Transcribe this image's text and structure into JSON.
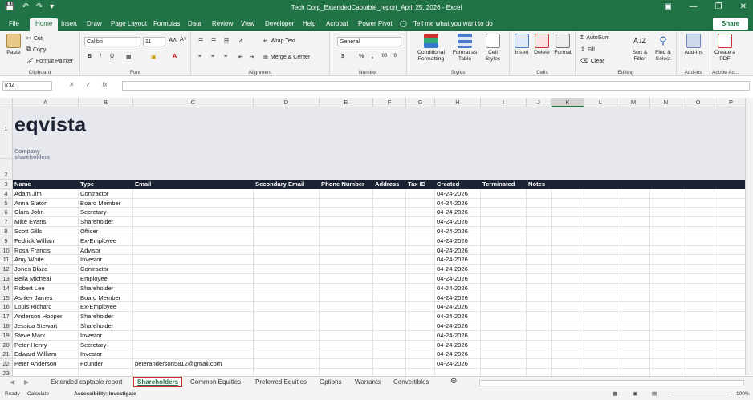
{
  "window": {
    "title": "Tech Corp_ExtendedCaptable_report_April 25, 2026  -  Excel"
  },
  "menu": {
    "tabs": [
      "File",
      "Home",
      "Insert",
      "Draw",
      "Page Layout",
      "Formulas",
      "Data",
      "Review",
      "View",
      "Developer",
      "Help",
      "Acrobat",
      "Power Pivot"
    ],
    "tell_me": "Tell me what you want to do",
    "share": "Share"
  },
  "ribbon": {
    "clipboard": {
      "paste": "Paste",
      "cut": "Cut",
      "copy": "Copy",
      "format_painter": "Format Painter",
      "label": "Clipboard"
    },
    "font": {
      "name": "Calibri",
      "size": "11",
      "label": "Font"
    },
    "alignment": {
      "wrap": "Wrap Text",
      "merge": "Merge & Center",
      "label": "Alignment"
    },
    "number": {
      "format": "General",
      "label": "Number"
    },
    "styles": {
      "conditional": "Conditional Formatting",
      "format_table": "Format as Table",
      "cell_styles": "Cell Styles",
      "label": "Styles"
    },
    "cells": {
      "insert": "Insert",
      "delete": "Delete",
      "format": "Format",
      "label": "Cells"
    },
    "editing": {
      "autosum": "AutoSum",
      "fill": "Fill",
      "clear": "Clear",
      "sort": "Sort & Filter",
      "find": "Find & Select",
      "label": "Editing"
    },
    "addins": {
      "addins": "Add-ins",
      "label": "Add-ins"
    },
    "adobe": {
      "create_pdf": "Create a PDF",
      "label": "Adobe Ac..."
    }
  },
  "formula_bar": {
    "name_box": "K34",
    "fx": "fx",
    "value": ""
  },
  "columns": [
    "A",
    "B",
    "C",
    "D",
    "E",
    "F",
    "G",
    "H",
    "I",
    "J",
    "K",
    "L",
    "M",
    "N",
    "O",
    "P"
  ],
  "sheet": {
    "logo": "eqvista",
    "subtitle": "Company shareholders",
    "headers": [
      "Name",
      "Type",
      "Email",
      "Secondary Email",
      "Phone Number",
      "Address",
      "Tax ID",
      "Created",
      "Terminated",
      "Notes"
    ],
    "rows": [
      {
        "row": "4",
        "name": "Adam Jim",
        "type": "Contractor",
        "email": "",
        "created": "04-24-2026"
      },
      {
        "row": "5",
        "name": "Anna Slaton",
        "type": "Board Member",
        "email": "",
        "created": "04-24-2026"
      },
      {
        "row": "6",
        "name": "Clara John",
        "type": "Secretary",
        "email": "",
        "created": "04-24-2026"
      },
      {
        "row": "7",
        "name": "Mike Evans",
        "type": "Shareholder",
        "email": "",
        "created": "04-24-2026"
      },
      {
        "row": "8",
        "name": "Scott Gills",
        "type": "Officer",
        "email": "",
        "created": "04-24-2026"
      },
      {
        "row": "9",
        "name": "Fedrick William",
        "type": "Ex-Employee",
        "email": "",
        "created": "04-24-2026"
      },
      {
        "row": "10",
        "name": "Rosa Francis",
        "type": "Advisor",
        "email": "",
        "created": "04-24-2026"
      },
      {
        "row": "11",
        "name": "Amy White",
        "type": "Investor",
        "email": "",
        "created": "04-24-2026"
      },
      {
        "row": "12",
        "name": "Jones Blaze",
        "type": "Contractor",
        "email": "",
        "created": "04-24-2026"
      },
      {
        "row": "13",
        "name": "Bella Micheal",
        "type": "Employee",
        "email": "",
        "created": "04-24-2026"
      },
      {
        "row": "14",
        "name": "Robert Lee",
        "type": "Shareholder",
        "email": "",
        "created": "04-24-2026"
      },
      {
        "row": "15",
        "name": "Ashley James",
        "type": "Board Member",
        "email": "",
        "created": "04-24-2026"
      },
      {
        "row": "16",
        "name": "Louis Richard",
        "type": "Ex-Employee",
        "email": "",
        "created": "04-24-2026"
      },
      {
        "row": "17",
        "name": "Anderson Hooper",
        "type": "Shareholder",
        "email": "",
        "created": "04-24-2026"
      },
      {
        "row": "18",
        "name": "Jessica Stewart",
        "type": "Shareholder",
        "email": "",
        "created": "04-24-2026"
      },
      {
        "row": "19",
        "name": "Steve Mark",
        "type": "Investor",
        "email": "",
        "created": "04-24-2026"
      },
      {
        "row": "20",
        "name": "Peter Henry",
        "type": "Secretary",
        "email": "",
        "created": "04-24-2026"
      },
      {
        "row": "21",
        "name": "Edward William",
        "type": "Investor",
        "email": "",
        "created": "04-24-2026"
      },
      {
        "row": "22",
        "name": "Peter Anderson",
        "type": "Founder",
        "email": "peteranderson5812@gmail.com",
        "created": "04-24-2026"
      }
    ]
  },
  "sheet_tabs": [
    "Extended captable report",
    "Shareholders",
    "Common Equities",
    "Preferred Equities",
    "Options",
    "Warrants",
    "Convertibles"
  ],
  "active_sheet": "Shareholders",
  "status": {
    "ready": "Ready",
    "calculate": "Calculate",
    "accessibility": "Accessibility: Investigate",
    "zoom": "100%"
  },
  "colors": {
    "excel_green": "#217346",
    "header_dark": "#1b2232",
    "title_band": "#e6e8ed"
  }
}
